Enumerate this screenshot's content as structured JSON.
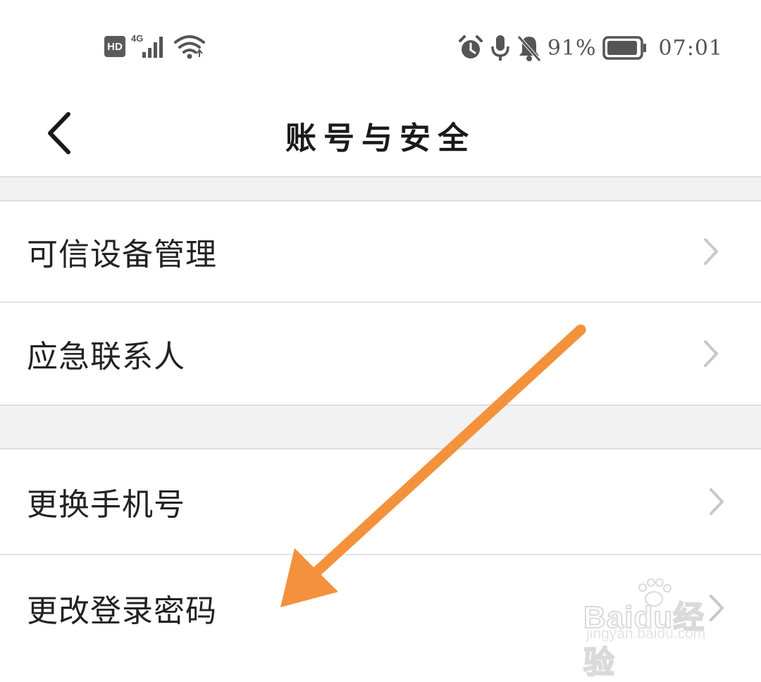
{
  "status_bar": {
    "hd_label": "HD",
    "network_label": "4G",
    "battery_percent": "91%",
    "battery_level": 0.91,
    "time": "07:01",
    "icons": [
      "hd-icon",
      "signal-icon",
      "wifi-icon",
      "alarm-icon",
      "microphone-icon",
      "bell-muted-icon",
      "battery-icon"
    ]
  },
  "header": {
    "title": "账号与安全",
    "back_icon": "chevron-left-icon"
  },
  "sections": [
    {
      "items": [
        {
          "label": "可信设备管理",
          "icon": "chevron-right-icon"
        },
        {
          "label": "应急联系人",
          "icon": "chevron-right-icon"
        }
      ]
    },
    {
      "items": [
        {
          "label": "更换手机号",
          "icon": "chevron-right-icon"
        },
        {
          "label": "更改登录密码",
          "icon": "chevron-right-icon"
        }
      ]
    }
  ],
  "annotation": {
    "type": "arrow",
    "color": "#f4913c",
    "points_to": "更改登录密码"
  },
  "watermark": {
    "main": "Baidu经验",
    "sub": "jingyan.baidu.com"
  },
  "colors": {
    "section_gap": "#f2f2f2",
    "divider": "#e3e3e3",
    "chevron": "#c8c8c8",
    "text": "#222222"
  }
}
